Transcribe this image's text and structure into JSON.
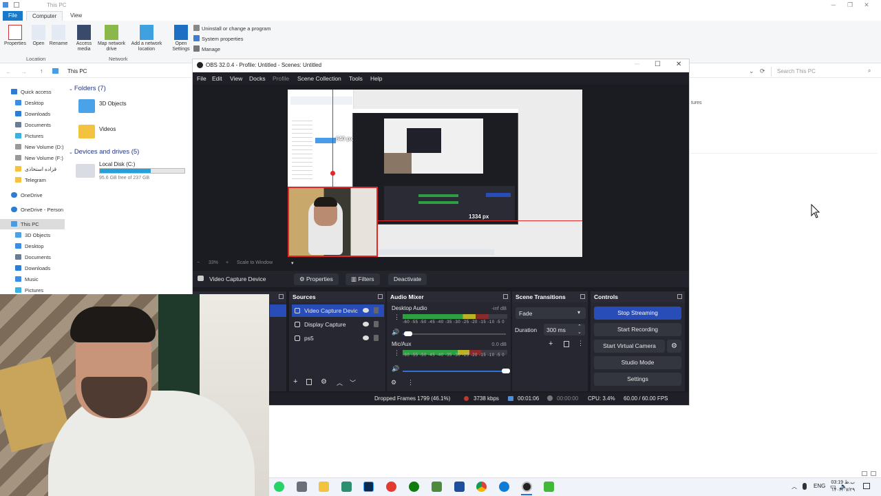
{
  "explorer": {
    "title": "This PC",
    "tabs": [
      "File",
      "Computer",
      "View"
    ],
    "ribbon_buttons": [
      "Properties",
      "Open",
      "Rename",
      "Access media",
      "Map network drive",
      "Add a network location",
      "Open Settings"
    ],
    "ribbon_small": [
      "Uninstall or change a program",
      "System properties",
      "Manage"
    ],
    "groups": [
      "Location",
      "Network"
    ],
    "breadcrumb": "This PC",
    "search_placeholder": "Search This PC",
    "nav": {
      "quick_access": "Quick access",
      "items": [
        "Desktop",
        "Downloads",
        "Documents",
        "Pictures",
        "New Volume (D:)",
        "New Volume (F:)",
        "قزاده استخاذی",
        "Telegram"
      ],
      "onedrive": "OneDrive",
      "onedrive_personal": "OneDrive - Person",
      "this_pc": "This PC",
      "pc_items": [
        "3D Objects",
        "Desktop",
        "Documents",
        "Downloads",
        "Music",
        "Pictures"
      ]
    },
    "folders_header": "Folders (7)",
    "folders": [
      "3D Objects",
      "Videos"
    ],
    "devices_header": "Devices and drives (5)",
    "drive": {
      "name": "Local Disk (C:)",
      "free": "95.6 GB free of 237 GB",
      "used_fraction": 0.6
    },
    "partial_right": "tures"
  },
  "obs": {
    "title": "OBS 32.0.4 - Profile: Untitled - Scenes: Untitled",
    "menu": [
      "File",
      "Edit",
      "View",
      "Docks",
      "Profile",
      "Scene Collection",
      "Tools",
      "Help"
    ],
    "preview_labels": {
      "width_px": "640 px",
      "right_px": "1334 px"
    },
    "zoom": {
      "minus": "−",
      "percent": "33%",
      "plus": "+",
      "scale": "Scale to Window"
    },
    "source_toolbar": {
      "selected": "Video Capture Device",
      "properties": "Properties",
      "filters": "Filters",
      "deactivate": "Deactivate"
    },
    "sources": {
      "title": "Sources",
      "items": [
        "Video Capture Devic",
        "Display Capture",
        "ps5"
      ]
    },
    "mixer": {
      "title": "Audio Mixer",
      "tracks": [
        {
          "name": "Desktop Audio",
          "db": "-inf dB",
          "level": 0.82,
          "volume": 0.05
        },
        {
          "name": "Mic/Aux",
          "db": "0.0 dB",
          "level": 0.75,
          "volume": 1.0
        }
      ],
      "ticks": "-60 -55 -50 -45 -40 -35 -30 -25 -20 -15 -10 -5 0"
    },
    "transitions": {
      "title": "Scene Transitions",
      "selected": "Fade",
      "duration_label": "Duration",
      "duration_value": "300 ms"
    },
    "controls": {
      "title": "Controls",
      "stop_streaming": "Stop Streaming",
      "start_recording": "Start Recording",
      "start_virtual_camera": "Start Virtual Camera",
      "studio_mode": "Studio Mode",
      "settings": "Settings"
    },
    "status": {
      "dropped": "Dropped Frames 1799 (46.1%)",
      "bitrate": "3738 kbps",
      "stream_time": "00:01:06",
      "rec_time": "00:00:00",
      "cpu": "CPU: 3.4%",
      "fps": "60.00 / 60.00 FPS"
    }
  },
  "taskbar": {
    "lang": "ENG",
    "time": "03:19 ب.ظ",
    "date": "۱۴۰۴/۰۷/۲۹"
  },
  "colors": {
    "obs_accent": "#284cb8",
    "obs_bg": "#1b1c22",
    "explorer_accent": "#1979ca"
  }
}
